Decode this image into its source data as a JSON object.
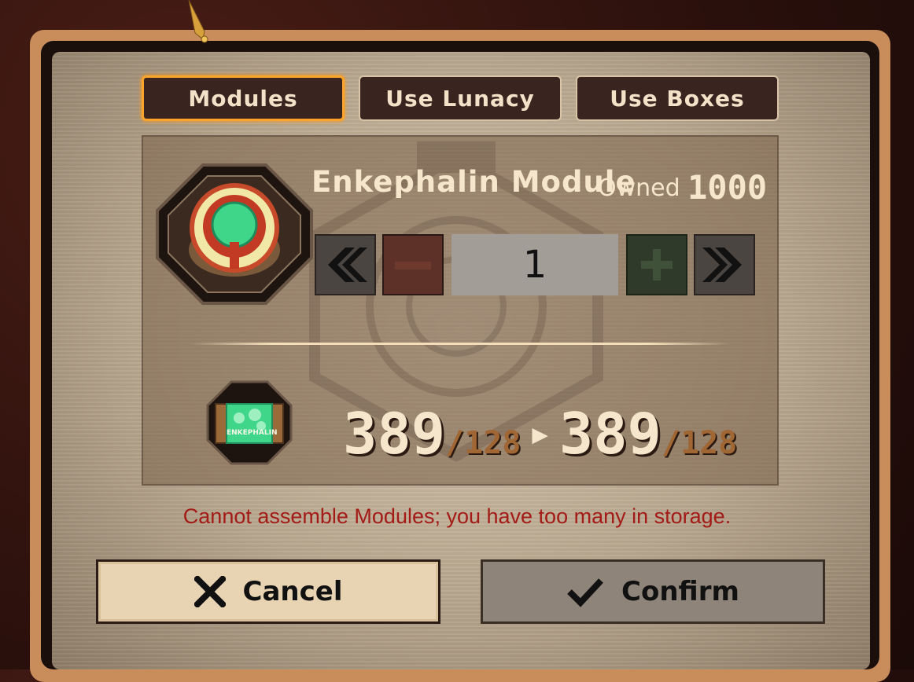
{
  "tabs": [
    {
      "label": "Modules",
      "active": true
    },
    {
      "label": "Use Lunacy",
      "active": false
    },
    {
      "label": "Use Boxes",
      "active": false
    }
  ],
  "item": {
    "name": "Enkephalin Module",
    "owned_label": "Owned",
    "owned_value": "1000",
    "icon": "enkephalin-module-icon"
  },
  "quantity": {
    "value": "1",
    "min_icon": "double-chevron-left-icon",
    "minus_icon": "minus-icon",
    "plus_icon": "plus-icon",
    "max_icon": "double-chevron-right-icon"
  },
  "resource": {
    "icon": "enkephalin-box-icon",
    "icon_label": "ENKEPHALIN",
    "before_current": "389",
    "before_max": "/128",
    "after_current": "389",
    "after_max": "/128"
  },
  "message": "Cannot assemble Modules; you have too many in storage.",
  "buttons": {
    "cancel_label": "Cancel",
    "confirm_label": "Confirm"
  },
  "colors": {
    "accent": "#ffa42a",
    "error": "#a31b16",
    "text_light": "#f6e6cc",
    "panel_dark": "#3a2420"
  }
}
